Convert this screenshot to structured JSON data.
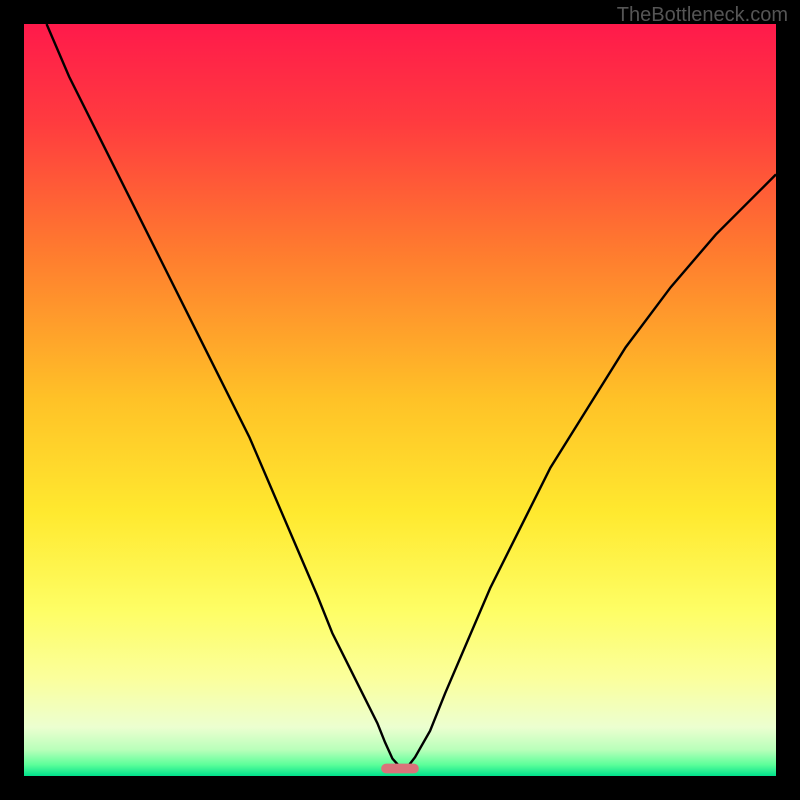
{
  "watermark": "TheBottleneck.com",
  "chart_data": {
    "type": "line",
    "title": "",
    "xlabel": "",
    "ylabel": "",
    "xlim": [
      0,
      100
    ],
    "ylim": [
      0,
      100
    ],
    "background_gradient": {
      "stops": [
        {
          "offset": 0.0,
          "color": "#ff1a4b"
        },
        {
          "offset": 0.13,
          "color": "#ff3b3f"
        },
        {
          "offset": 0.3,
          "color": "#ff7a2f"
        },
        {
          "offset": 0.5,
          "color": "#ffc227"
        },
        {
          "offset": 0.65,
          "color": "#ffe92f"
        },
        {
          "offset": 0.78,
          "color": "#fefe65"
        },
        {
          "offset": 0.87,
          "color": "#fbff9c"
        },
        {
          "offset": 0.935,
          "color": "#ecffd0"
        },
        {
          "offset": 0.965,
          "color": "#b9ffba"
        },
        {
          "offset": 0.985,
          "color": "#5dff9a"
        },
        {
          "offset": 1.0,
          "color": "#00e18b"
        }
      ]
    },
    "series": [
      {
        "name": "bottleneck-curve",
        "color": "#000000",
        "x": [
          3,
          6,
          10,
          14,
          18,
          22,
          26,
          30,
          33,
          36,
          39,
          41,
          43,
          45,
          47,
          48,
          49,
          50,
          51,
          52,
          54,
          56,
          59,
          62,
          66,
          70,
          75,
          80,
          86,
          92,
          98,
          100
        ],
        "y": [
          100,
          93,
          85,
          77,
          69,
          61,
          53,
          45,
          38,
          31,
          24,
          19,
          15,
          11,
          7,
          4.5,
          2.3,
          1.2,
          1.2,
          2.5,
          6,
          11,
          18,
          25,
          33,
          41,
          49,
          57,
          65,
          72,
          78,
          80
        ]
      }
    ],
    "marker": {
      "name": "min-marker",
      "x": 50,
      "y": 1,
      "width": 5,
      "height": 1.3,
      "color": "#d9737a"
    }
  }
}
